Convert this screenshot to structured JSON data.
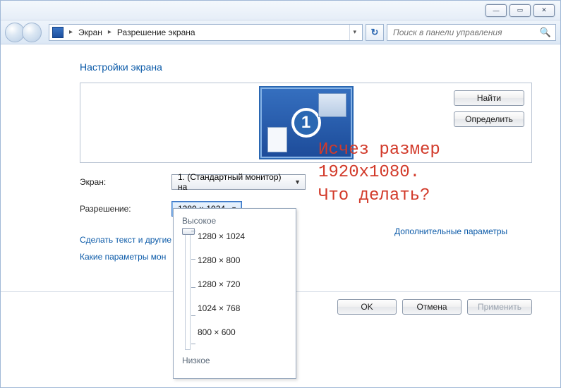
{
  "window": {
    "minimize_glyph": "—",
    "maximize_glyph": "▭",
    "close_glyph": "✕"
  },
  "nav": {
    "back_glyph": "",
    "forward_glyph": ""
  },
  "breadcrumb": {
    "seg1": "Экран",
    "seg2": "Разрешение экрана"
  },
  "search": {
    "placeholder": "Поиск в панели управления"
  },
  "refresh_glyph": "↻",
  "heading": "Настройки экрана",
  "monitor_number": "1",
  "buttons": {
    "find": "Найти",
    "identify": "Определить",
    "ok": "OK",
    "cancel": "Отмена",
    "apply": "Применить"
  },
  "labels": {
    "screen": "Экран:",
    "resolution": "Разрешение:"
  },
  "combos": {
    "screen_value": "1. (Стандартный монитор) на",
    "resolution_value": "1280 × 1024"
  },
  "links": {
    "text_size": "Сделать текст и другие",
    "which_params": "Какие параметры мон",
    "advanced": "Дополнительные параметры"
  },
  "slider": {
    "high": "Высокое",
    "low": "Низкое",
    "options": [
      "1280 × 1024",
      "1280 × 800",
      "1280 × 720",
      "1024 × 768",
      "800 × 600"
    ]
  },
  "annotation": "Исчез размер\n1920x1080.\nЧто делать?"
}
